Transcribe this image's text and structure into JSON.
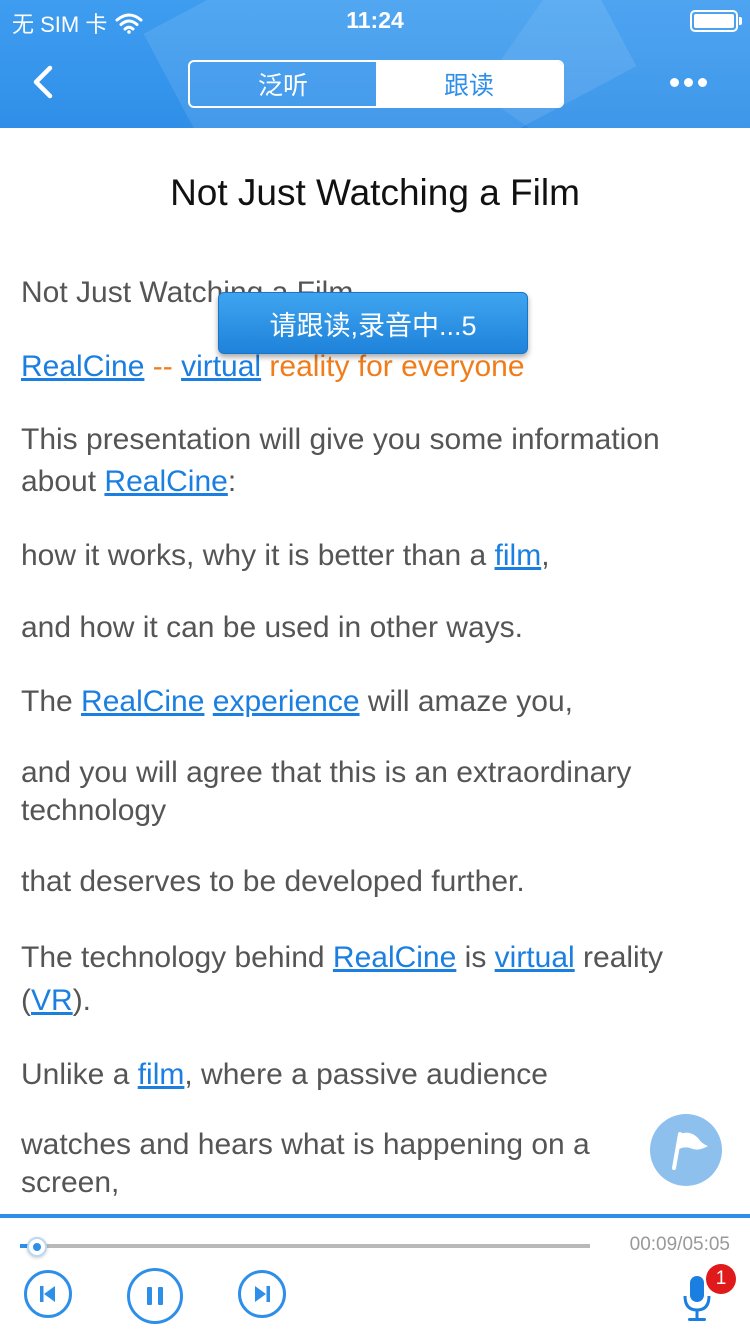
{
  "status_bar": {
    "carrier": "无 SIM 卡",
    "time": "11:24"
  },
  "header": {
    "tabs": [
      {
        "label": "泛听",
        "active": false
      },
      {
        "label": "跟读",
        "active": true
      }
    ]
  },
  "article": {
    "title": "Not Just Watching a Film",
    "paragraphs": {
      "p1": "Not Just Watching a Film",
      "p2": {
        "link1": "RealCine",
        "sep": " -- ",
        "link2": "virtual",
        "rest": " reality for everyone"
      },
      "p3": {
        "text": "This presentation will give you some information about ",
        "link": "RealCine",
        "after": ":"
      },
      "p4": {
        "text": "how it works, why it is better than a ",
        "link": "film",
        "after": ","
      },
      "p5": "and how it can be used in other ways.",
      "p6": {
        "before": "The ",
        "link1": "RealCine",
        "link2": "experience",
        "after": " will amaze you,"
      },
      "p7": "and you will agree that this is an extraordinary technology",
      "p8": "that deserves to be developed further.",
      "p9": {
        "before": "The technology behind ",
        "link1": "RealCine",
        "mid": " is ",
        "link2": "virtual",
        "mid2": " reality (",
        "link3": "VR",
        "after": ")."
      },
      "p10": {
        "before": "Unlike a ",
        "link": "film",
        "after": ", where a passive audience"
      },
      "p11": "watches and hears what is happening on a screen,"
    }
  },
  "toast": {
    "text": "请跟读,录音中...5"
  },
  "player": {
    "time": "00:09/05:05",
    "progress": 0.03,
    "badge_count": "1"
  },
  "colors": {
    "accent": "#2f8fe8",
    "link": "#1a7fe0",
    "highlight": "#f07d1a",
    "badge": "#e01a1a"
  }
}
